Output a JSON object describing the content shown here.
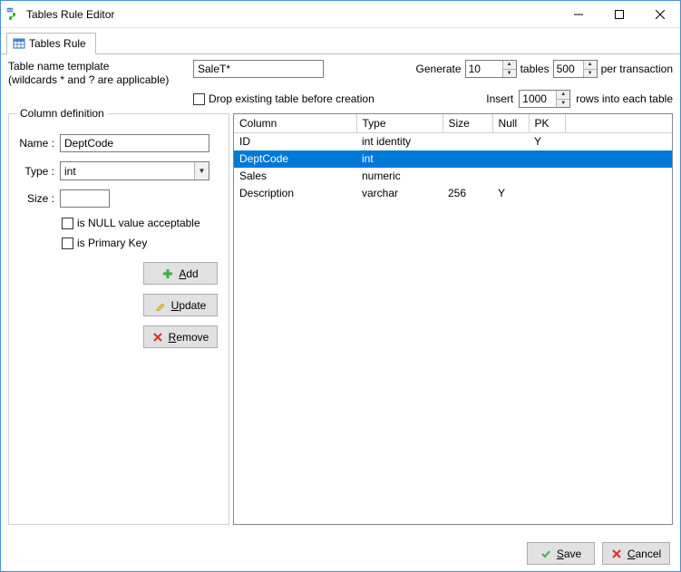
{
  "window": {
    "title": "Tables Rule Editor"
  },
  "tab": {
    "label": "Tables Rule"
  },
  "template": {
    "label_line1": "Table name template",
    "label_line2": "(wildcards * and ? are applicable)",
    "value": "SaleT*",
    "drop_existing": "Drop existing table before creation"
  },
  "generate": {
    "label": "Generate",
    "count": "10",
    "tables_label": "tables",
    "ptx": "500",
    "ptx_label": "per transaction"
  },
  "insert": {
    "label": "Insert",
    "count": "1000",
    "rows_label": "rows into each table"
  },
  "coldef": {
    "legend": "Column definition",
    "name_label": "Name :",
    "name_value": "DeptCode",
    "type_label": "Type :",
    "type_value": "int",
    "size_label": "Size :",
    "size_value": "",
    "null_label": "is NULL value acceptable",
    "pk_label": "is Primary Key",
    "add": "Add",
    "update": "Update",
    "remove": "Remove"
  },
  "grid": {
    "headers": {
      "column": "Column",
      "type": "Type",
      "size": "Size",
      "null": "Null",
      "pk": "PK"
    },
    "rows": [
      {
        "column": "ID",
        "type": "int identity",
        "size": "",
        "null": "",
        "pk": "Y",
        "selected": false
      },
      {
        "column": "DeptCode",
        "type": "int",
        "size": "",
        "null": "",
        "pk": "",
        "selected": true
      },
      {
        "column": "Sales",
        "type": "numeric",
        "size": "",
        "null": "",
        "pk": "",
        "selected": false
      },
      {
        "column": "Description",
        "type": "varchar",
        "size": "256",
        "null": "Y",
        "pk": "",
        "selected": false
      }
    ]
  },
  "footer": {
    "save": "Save",
    "cancel": "Cancel"
  }
}
